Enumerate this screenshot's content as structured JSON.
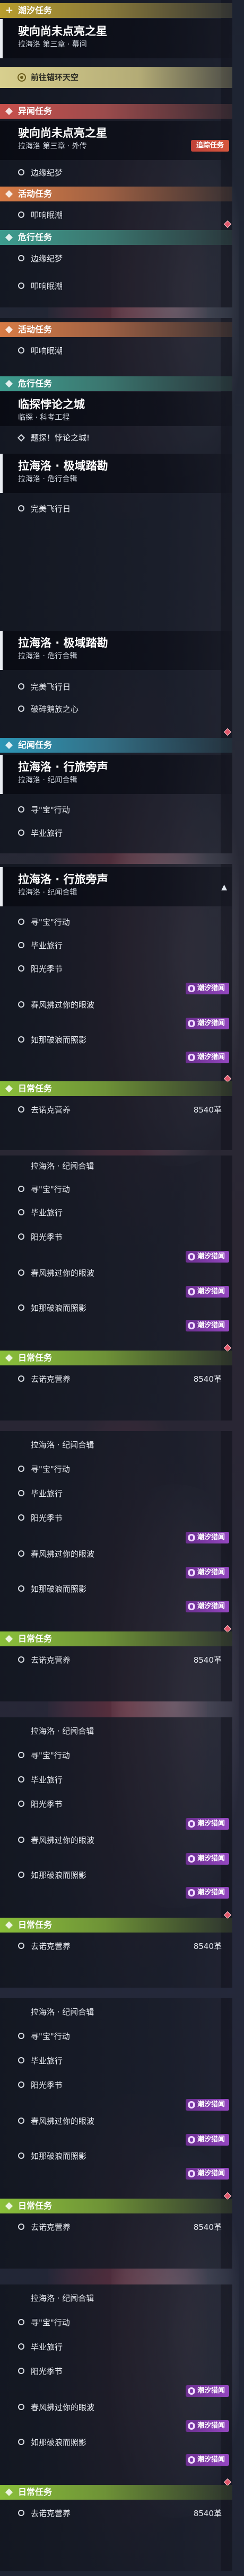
{
  "categories": {
    "chaoxi": "潮汐任务",
    "yiwen": "异闻任务",
    "huodong": "活动任务",
    "weixing": "危行任务",
    "jiwen": "纪闻任务",
    "richang": "日常任务"
  },
  "quest_a": {
    "title": "驶向尚未点亮之星",
    "subtitle": "拉海洛 第三章 · 幕间"
  },
  "quest_b": {
    "title": "驶向尚未点亮之星",
    "subtitle": "拉海洛 第三章 · 外传"
  },
  "quest_c": {
    "title": "临探悖论之城",
    "subtitle": "临探 · 科考工程"
  },
  "quest_d": {
    "title": "拉海洛 · 极域踏勘",
    "subtitle": "拉海洛 · 危行合辑"
  },
  "quest_e": {
    "title": "拉海洛 · 行旅旁声",
    "subtitle": "拉海洛 · 纪闻合辑"
  },
  "quest_f_subtitle": "拉海洛 · 纪闻合辑",
  "objectives": {
    "anchor": "前往锚环天空",
    "birthday": "边缘纪梦",
    "delivery": "叩响眠潮",
    "delivery2": "叩响眠潮",
    "puzzle": "题探！悖论之城!",
    "find_star": "完美飞行日",
    "find_star2": "完美飞行日",
    "lecture": "破碎鹅族之心",
    "xun": "寻\"宝\"行动",
    "farewell": "毕业旅行",
    "sunlight": "阳光季节",
    "clarify": "春风拂过你的眼波",
    "hunt": "如那破浪而照影",
    "daily": "去诺克营养",
    "daily_reward": "8540革"
  },
  "tags": {
    "chaoxi": "潮汐猎闻",
    "track": "追踪任务"
  },
  "icons": {
    "mark": "diamond-icon",
    "ring": "ring-icon",
    "target": "target-icon",
    "collapse": "chevron-up-icon"
  }
}
